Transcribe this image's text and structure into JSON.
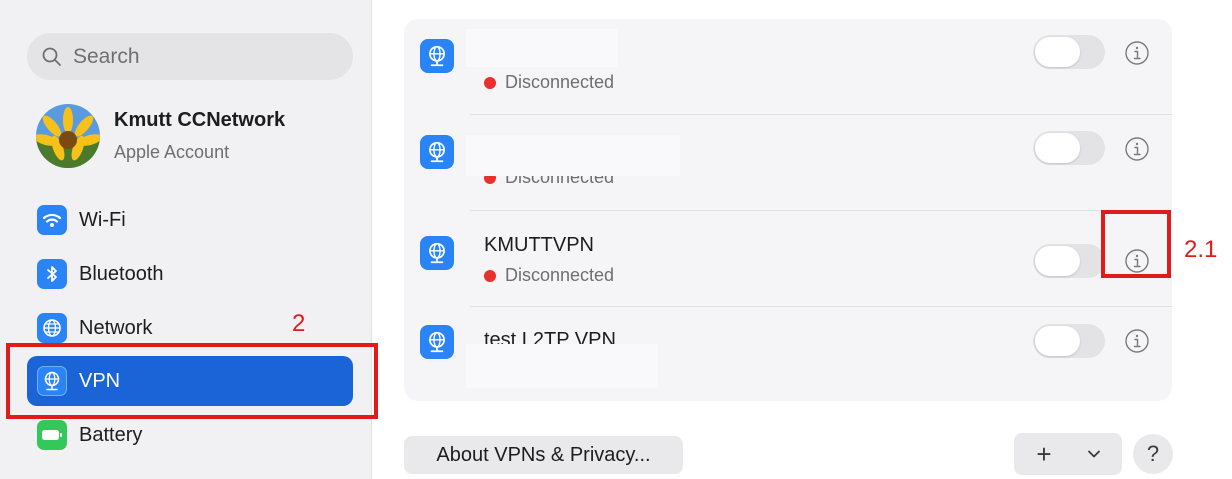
{
  "search": {
    "placeholder": "Search",
    "icon": "search-icon"
  },
  "account": {
    "name": "Kmutt CCNetwork",
    "subtitle": "Apple Account"
  },
  "sidebar": {
    "items": [
      {
        "label": "Wi-Fi",
        "icon": "wifi-icon",
        "color": "#2a84f6"
      },
      {
        "label": "Bluetooth",
        "icon": "bluetooth-icon",
        "color": "#2a84f6"
      },
      {
        "label": "Network",
        "icon": "network-globe-icon",
        "color": "#2a84f6"
      },
      {
        "label": "VPN",
        "icon": "vpn-globe-icon",
        "color": "#2a84f6",
        "active": true
      },
      {
        "label": "Battery",
        "icon": "battery-icon",
        "color": "#34c759"
      }
    ],
    "active_color": "#1a64d8"
  },
  "vpn_list": [
    {
      "name": "",
      "status": "Disconnected",
      "enabled": false
    },
    {
      "name": "",
      "status": "Disconnected",
      "enabled": false
    },
    {
      "name": "KMUTTVPN",
      "status": "Disconnected",
      "enabled": false
    },
    {
      "name": "test L2TP VPN",
      "status": "",
      "enabled": false
    }
  ],
  "buttons": {
    "about": "About VPNs & Privacy...",
    "add": "+",
    "help": "?"
  },
  "annotations": {
    "step": "2",
    "substep": "2.1",
    "color": "#e01b1b"
  },
  "status_color": "#e8302c"
}
